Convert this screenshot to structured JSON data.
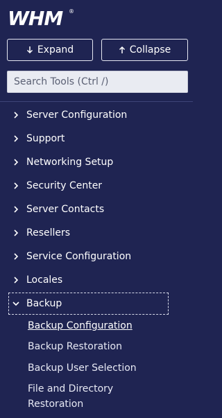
{
  "brand": {
    "logo_text": "WHM"
  },
  "toolbar": {
    "expand_label": "Expand",
    "collapse_label": "Collapse"
  },
  "search": {
    "placeholder": "Search Tools (Ctrl /)"
  },
  "nav": {
    "items": [
      {
        "label": "Server Configuration",
        "state": "collapsed"
      },
      {
        "label": "Support",
        "state": "collapsed"
      },
      {
        "label": "Networking Setup",
        "state": "collapsed"
      },
      {
        "label": "Security Center",
        "state": "collapsed"
      },
      {
        "label": "Server Contacts",
        "state": "collapsed"
      },
      {
        "label": "Resellers",
        "state": "collapsed"
      },
      {
        "label": "Service Configuration",
        "state": "collapsed"
      },
      {
        "label": "Locales",
        "state": "collapsed"
      },
      {
        "label": "Backup",
        "state": "expanded"
      }
    ],
    "backup_children": [
      {
        "label": "Backup Configuration",
        "active": true
      },
      {
        "label": "Backup Restoration",
        "active": false
      },
      {
        "label": "Backup User Selection",
        "active": false
      },
      {
        "label": "File and Directory Restoration",
        "active": false
      }
    ]
  },
  "colors": {
    "sidebar_bg": "#1f2452",
    "text": "#ffffff",
    "search_bg": "#e9ebf2"
  }
}
